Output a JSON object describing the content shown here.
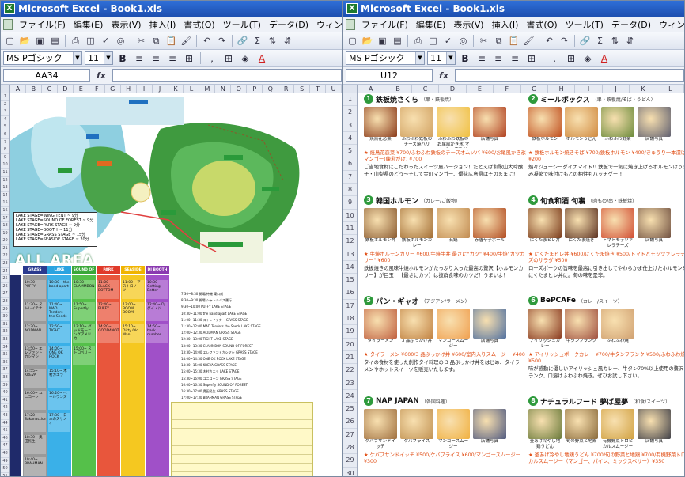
{
  "left_window": {
    "title": "Microsoft Excel - Book1.xls",
    "menus": [
      "ファイル(F)",
      "編集(E)",
      "表示(V)",
      "挿入(I)",
      "書式(O)",
      "ツール(T)",
      "データ(D)",
      "ウィンドウ(W)"
    ],
    "font_name": "MS Pゴシック",
    "font_size": "11",
    "name_box": "AA34",
    "fx_label": "fx",
    "columns": [
      "A",
      "B",
      "C",
      "D",
      "E",
      "F",
      "G",
      "H",
      "I",
      "J",
      "K",
      "L",
      "M",
      "N",
      "O",
      "P",
      "Q",
      "R",
      "S",
      "T",
      "U"
    ],
    "map_legend": [
      "LAKE STAGE=WING TENT ~ 9分",
      "LAKE STAGE=SOUND OF FOREST ~ 9分",
      "LAKE STAGE=PARK STAGE ~ 9分",
      "LAKE STAGE=BOOTH ~ 11分",
      "LAKE STAGE=GRASS STAGE ~ 15分",
      "LAKE STAGE=SEASIDE STAGE ~ 20分"
    ],
    "all_area": "ALL AREA",
    "stages": [
      {
        "name": "GRASS STAGE",
        "color": "#2b3a8f",
        "colbg": "#9a9a9a"
      },
      {
        "name": "LAKE STAGE",
        "color": "#2aa3e0",
        "colbg": "#3ab0e8"
      },
      {
        "name": "SOUND OF FOREST",
        "color": "#3aa83a",
        "colbg": "#55c04a"
      },
      {
        "name": "PARK STAGE",
        "color": "#e03a2a",
        "colbg": "#e8563c"
      },
      {
        "name": "SEASIDE STAGE",
        "color": "#f0b400",
        "colbg": "#f5c820"
      },
      {
        "name": "DJ BOOTH",
        "color": "#8a3ab0",
        "colbg": "#a050c8"
      }
    ],
    "slots": [
      {
        "col": 0,
        "text": "10:30~ PUFFY"
      },
      {
        "col": 0,
        "text": "11:30~ ストレイテナー"
      },
      {
        "col": 0,
        "text": "12:30~ ACIDMAN"
      },
      {
        "col": 0,
        "text": "13:50~ エレファントカシマシ"
      },
      {
        "col": 0,
        "text": "14:55~ KREVA"
      },
      {
        "col": 0,
        "text": "16:00~ ユニコーン"
      },
      {
        "col": 0,
        "text": "17:20~ Sakanaction"
      },
      {
        "col": 0,
        "text": "18:30~ 奥田民生"
      },
      {
        "col": 0,
        "text": "19:40~ BRAHMAN"
      },
      {
        "col": 1,
        "text": "10:30~ the band apart"
      },
      {
        "col": 1,
        "text": "11:40~ MAD Tenders the Seeds"
      },
      {
        "col": 1,
        "text": "12:50~ TIGHT"
      },
      {
        "col": 1,
        "text": "14:00~ ONE OK ROCK"
      },
      {
        "col": 1,
        "text": "15:10~ 木村カエラ"
      },
      {
        "col": 1,
        "text": "16:20~ ペールワンズ"
      },
      {
        "col": 1,
        "text": "17:30~ 日本のスサノオ"
      },
      {
        "col": 2,
        "text": "10:30~ CLAMMBON"
      },
      {
        "col": 2,
        "text": "11:50~ Superfly"
      },
      {
        "col": 2,
        "text": "13:10~ グッドモーニングアメリカ"
      },
      {
        "col": 2,
        "text": "15:00~ ストロベリー"
      },
      {
        "col": 3,
        "text": "11:00~ BLACK BOTTOM"
      },
      {
        "col": 3,
        "text": "12:40~ PUFFY"
      },
      {
        "col": 3,
        "text": "14:20~ GOOD4NOTHING"
      },
      {
        "col": 4,
        "text": "11:00~ アストロノーツ"
      },
      {
        "col": 4,
        "text": "13:00~ BOOM BOOM"
      },
      {
        "col": 4,
        "text": "15:10~ Dirty Old Man"
      },
      {
        "col": 5,
        "text": "10:30~ Getting Better"
      },
      {
        "col": 5,
        "text": "12:40~ DJ ダイノジ"
      },
      {
        "col": 5,
        "text": "14:50~ back number"
      }
    ],
    "schedule": [
      "7:30~8:30 開場/待機 東口前",
      "8:30~9:30 開場 シャトルバス運行",
      "9:30~10:00 PUFFY LAKE STAGE",
      "10:30~11:00 the band apart LAKE STAGE",
      "11:00~11:30 ストレイテナー GRASS STAGE",
      "11:30~12:00 MAD Tenders the Seeds LAKE STAGE",
      "12:00~12:30 ACIDMAN GRASS STAGE",
      "12:30~13:00 TIGHT LAKE STAGE",
      "13:00~13:30 CLAMMBON SOUND OF FOREST",
      "13:30~14:00 エレファントカシマシ GRASS STAGE",
      "14:00~14:30 ONE OK ROCK LAKE STAGE",
      "14:30~15:00 KREVA GRASS STAGE",
      "15:00~15:30 木村カエラ LAKE STAGE",
      "15:30~16:00 ユニコーン GRASS STAGE",
      "16:00~16:30 Superfly SOUND OF FOREST",
      "16:30~17:00 奥田民生 GRASS STAGE",
      "17:00~17:30 BRAHMAN GRASS STAGE",
      "17:30~18:00 終演 退場"
    ]
  },
  "right_window": {
    "title": "Microsoft Excel - Book1.xls",
    "menus": [
      "ファイル(F)",
      "編集(E)",
      "表示(V)",
      "挿入(I)",
      "書式(O)",
      "ツール(T)",
      "データ(D)",
      "ウィンドウ(W)"
    ],
    "font_name": "MS Pゴシック",
    "font_size": "11",
    "name_box": "U12",
    "fx_label": "fx",
    "columns": [
      "A",
      "B",
      "C",
      "D",
      "E",
      "F",
      "G",
      "H",
      "I",
      "J",
      "K",
      "L"
    ],
    "shops": [
      {
        "num": "1",
        "name": "鉄板焼さくら",
        "sub": "（串・鉄板焼）",
        "photos": [
          {
            "cap": "焼鳥花恋菜",
            "color": "#8a3a1a"
          },
          {
            "cap": "ふわふわ鉄板のチーズ焼ハリ",
            "color": "#d0a060"
          },
          {
            "cap": "ふわふわ鉄板のお尾風かき氷 マンゴー(練乳がけ)",
            "color": "#f0c040"
          },
          {
            "cap": "店舗写真",
            "color": "#b04020"
          }
        ],
        "price": "★ 焼鳥花恋菜 ¥700/ふわふわ鉄板のチーズオムソバ ¥600/お尾風かき氷 マンゴー(練乳がけ) ¥700",
        "desc": "ご当地食材にこだわったスイーツ屋バージョン！たとえば和歌山大吟醸子・山梨県のどう～そして金町マンゴー、優花広島県はそのままに！"
      },
      {
        "num": "2",
        "name": "ミールボックス",
        "sub": "（串・鉄板焼/そば・うどん）",
        "photos": [
          {
            "cap": "鉄板ホルモン",
            "color": "#c05020"
          },
          {
            "cap": "ホルモンうどん",
            "color": "#d08a40"
          },
          {
            "cap": "ふわふわ野菜",
            "color": "#6a8a3a"
          },
          {
            "cap": "店舗写真",
            "color": "#606070"
          }
        ],
        "price": "★ 鉄板ホルモン焼きそば ¥700/鉄板ホルモン ¥400/きゅうり一本漬け ¥200",
        "desc": "熱々ジューシーダイナマイト!! 鉄板で一気に焼き上げるホルモンはうまみ凝縮で味付けもとの相性もバッチグー!!"
      },
      {
        "num": "3",
        "name": "韓国ホルモン",
        "sub": "（カレー/ご飯物）",
        "photos": [
          {
            "cap": "鉄板ホルモン丼",
            "color": "#8a5a30"
          },
          {
            "cap": "鉄板ホルモンカレー",
            "color": "#a06a30"
          },
          {
            "cap": "石鍋",
            "color": "#c08a50"
          },
          {
            "cap": "赤唐辛子ボール",
            "color": "#b04a20"
          }
        ],
        "price": "★ 牛焼ホルモンカリー ¥600/牛焼牛丼 最さに\"カツ\" ¥400/牛焼\"カツカリー\" ¥600",
        "desc": "鉄板焼きの風味牛焼ホルモンがたっぷり入った最高の贅沢【ホルモンカリー】が目玉！【最さにカツ】は抜群食味のカツだ！うまいよ！"
      },
      {
        "num": "4",
        "name": "旬食和酒 旬裏",
        "sub": "（肉もの/串・鉄板焼）",
        "photos": [
          {
            "cap": "にくたまヒレ丼",
            "color": "#7a3a1a"
          },
          {
            "cap": "にくたま焼き",
            "color": "#5a3020"
          },
          {
            "cap": "トマトモッツァレラチーズ",
            "color": "#d04a30"
          },
          {
            "cap": "店舗写真",
            "color": "#705040"
          }
        ],
        "price": "★ にくたまヒレ丼 ¥600/にくたま焼き ¥500/トマトとモッツァレラチーズのサラダ ¥500",
        "desc": "ローズポークの旨味を最高に引き出してやわらかま仕上げたホルモンをにくたまヒレ丼に。旬の味を是非。"
      },
      {
        "num": "5",
        "name": "パン・ギャオ",
        "sub": "（アジアン/ラーメン）",
        "photos": [
          {
            "cap": "タイラーメン",
            "color": "#c06040"
          },
          {
            "cap": "3 品ぶっかけ丼",
            "color": "#c08040"
          },
          {
            "cap": "マンゴースムージー",
            "color": "#f0a050"
          },
          {
            "cap": "店舗写真",
            "color": "#5070a0"
          }
        ],
        "price": "★ タイラーメン ¥600/3 品ぶっかけ丼 ¥600/室内入りスムージー ¥400",
        "desc": "タイの食材を使った創作タイ料理の 3 品ぶっかけ丼をはじめ、タイラーメンやホットスイーツを販売いたします。"
      },
      {
        "num": "6",
        "name": "BePCAFe",
        "sub": "（カレー/スイーツ）",
        "photos": [
          {
            "cap": "アイリッシュカレー",
            "color": "#8a3a20"
          },
          {
            "cap": "牛タンフランク",
            "color": "#a05040"
          },
          {
            "cap": "ふわふわ焼",
            "color": "#d0a070"
          },
          {
            "cap": "",
            "color": "#ffffff"
          }
        ],
        "price": "★ アイリッシュポークカレー ¥700/牛タンフランク ¥500/ふわふわ焼 ¥500",
        "desc": "味が感動に優しいアイリッシュ風カレー、牛タン70%以上使用の贅沢フランク、口溶けふわふわ焼き。ぜひお試し下さい。"
      },
      {
        "num": "7",
        "name": "NAP JAPAN",
        "sub": "（各国料理）",
        "photos": [
          {
            "cap": "ケバブサンドイッチ",
            "color": "#a07040"
          },
          {
            "cap": "ケバブライス",
            "color": "#c09050"
          },
          {
            "cap": "マンゴースムージー",
            "color": "#f0b040"
          },
          {
            "cap": "店舗写真",
            "color": "#505a80"
          }
        ],
        "price": "★ ケバブサンドイッチ ¥500/ケバブライス ¥600/マンゴースムージー ¥300",
        "desc": ""
      },
      {
        "num": "8",
        "name": "ナチュラルフード 夢ば屋夢",
        "sub": "（和食/スイーツ）",
        "photos": [
          {
            "cap": "釜あげ冷やし地鶏うどん",
            "color": "#6a7a3a"
          },
          {
            "cap": "旬の野菜と地鶏",
            "color": "#8a6a3a"
          },
          {
            "cap": "有機野菜トロピカルスムージー",
            "color": "#d0a040"
          },
          {
            "cap": "店舗写真",
            "color": "#404048"
          }
        ],
        "price": "★ 釜あげ冷やし地鶏うどん ¥700/旬の野菜と地鶏 ¥700/有機野菜トロピカルスムージー（マンゴー、パイン、ミックスベリー）¥350",
        "desc": ""
      }
    ]
  }
}
